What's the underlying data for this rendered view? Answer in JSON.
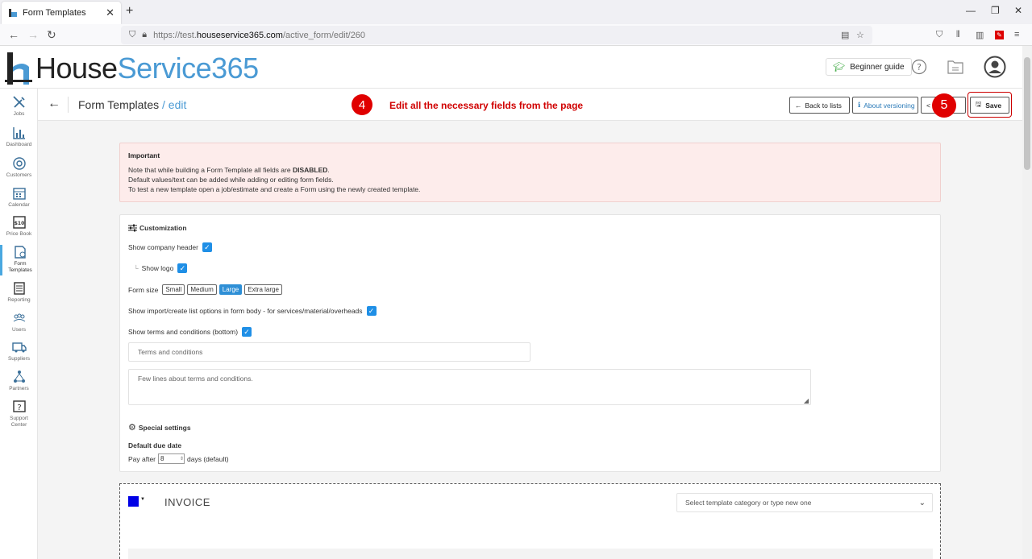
{
  "browser": {
    "tab_title": "Form Templates",
    "new_tab": "+",
    "url_prefix": "https://test.",
    "url_domain": "houseservice365.com",
    "url_path": "/active_form/edit/260"
  },
  "header": {
    "logo_house": "House",
    "logo_service": "Service365",
    "beginner_guide": "Beginner guide"
  },
  "sidebar": {
    "items": [
      {
        "label": "Jobs",
        "icon": "tools-icon"
      },
      {
        "label": "Dashboard",
        "icon": "chart-icon"
      },
      {
        "label": "Customers",
        "icon": "target-icon"
      },
      {
        "label": "Calendar",
        "icon": "calendar-icon"
      },
      {
        "label": "Price Book",
        "icon": "price-tag-icon",
        "badge": "$10"
      },
      {
        "label": "Form\nTemplates",
        "icon": "form-icon"
      },
      {
        "label": "Reporting",
        "icon": "report-icon"
      },
      {
        "label": "Users",
        "icon": "users-icon"
      },
      {
        "label": "Suppliers",
        "icon": "truck-icon"
      },
      {
        "label": "Partners",
        "icon": "network-icon"
      },
      {
        "label": "Support\nCenter",
        "icon": "question-icon",
        "glyph": "?"
      }
    ]
  },
  "pagebar": {
    "title": "Form Templates",
    "subtitle": "/ edit",
    "step4_number": "4",
    "step4_text": "Edit all the necessary fields from the page",
    "step5_number": "5",
    "back_to_lists": "Back to lists",
    "about_versioning": "About versioning",
    "save": "Save"
  },
  "alert": {
    "heading": "Important",
    "line1_pre": "Note that while building a Form Template all fields are ",
    "line1_strong": "DISABLED",
    "line1_post": ".",
    "line2": "Default values/text can be added while adding or editing form fields.",
    "line3": "To test a new template open a job/estimate and create a Form using the newly created template."
  },
  "customization": {
    "heading": "Customization",
    "show_company_header": "Show company header",
    "show_logo": "Show logo",
    "form_size_label": "Form size",
    "sizes": [
      "Small",
      "Medium",
      "Large",
      "Extra large"
    ],
    "selected_size": "Large",
    "show_import": "Show import/create list options in form body - for services/material/overheads",
    "show_terms": "Show terms and conditions (bottom)",
    "terms_title_placeholder": "Terms and conditions",
    "terms_body_placeholder": "Few lines about terms and conditions."
  },
  "special": {
    "heading": "Special settings",
    "due_date_label": "Default due date",
    "pay_after": "Pay after",
    "days_value": "8",
    "days_suffix": "days (default)"
  },
  "invoice": {
    "title": "INVOICE",
    "swatch_color": "#0000e6",
    "category_placeholder": "Select template category or type new one"
  },
  "colors": {
    "accent": "#4a9ad4",
    "step_red": "#e00000",
    "checkbox_blue": "#1f8fe6"
  }
}
